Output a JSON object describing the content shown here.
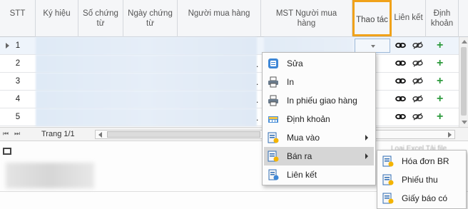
{
  "grid": {
    "columns": [
      {
        "label": "STT"
      },
      {
        "label": "Ký hiệu"
      },
      {
        "label": "Số chứng từ"
      },
      {
        "label": "Ngày chứng từ"
      },
      {
        "label": "Người mua hàng"
      },
      {
        "label": "MST Người mua hàng"
      },
      {
        "label": "Thao tác"
      },
      {
        "label": "Liên kết"
      },
      {
        "label": "Định khoản"
      }
    ],
    "rows": [
      {
        "stt": "1"
      },
      {
        "stt": "2"
      },
      {
        "stt": "3"
      },
      {
        "stt": "4"
      },
      {
        "stt": "5"
      }
    ],
    "row_dot": ".",
    "plus_symbol": "+"
  },
  "footer": {
    "first_label": "⏮",
    "last_label": "⏭",
    "page_label": "Trang 1/1"
  },
  "background_text": "Loại Excel Tải file",
  "context_menu": {
    "items": [
      {
        "label": "Sửa",
        "icon": "edit-form-icon"
      },
      {
        "label": "In",
        "icon": "printer-icon"
      },
      {
        "label": "In phiếu giao hàng",
        "icon": "printer-icon"
      },
      {
        "label": "Định khoản",
        "icon": "ledger-icon"
      },
      {
        "label": "Mua vào",
        "icon": "purchase-icon"
      },
      {
        "label": "Bán ra",
        "icon": "sale-icon"
      },
      {
        "label": "Liên kết",
        "icon": "link-doc-icon"
      }
    ]
  },
  "submenu": {
    "items": [
      {
        "label": "Hóa đơn BR",
        "icon": "invoice-icon"
      },
      {
        "label": "Phiếu thu",
        "icon": "receipt-icon"
      },
      {
        "label": "Giấy báo có",
        "icon": "credit-note-icon"
      }
    ]
  },
  "colors": {
    "highlight": "#f0a21a",
    "plus": "#2c9a3c",
    "menu_active": "#d6d6d6"
  }
}
